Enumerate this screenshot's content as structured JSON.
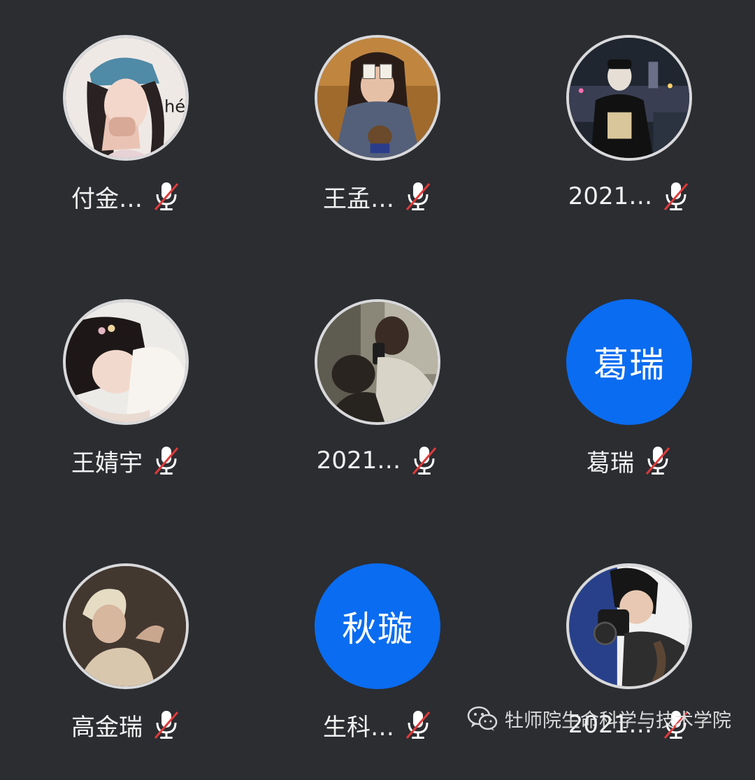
{
  "participants": [
    {
      "name": "付金…",
      "avatar": "photo",
      "mic": "muted"
    },
    {
      "name": "王孟…",
      "avatar": "photo",
      "mic": "muted"
    },
    {
      "name": "2021…",
      "avatar": "photo",
      "mic": "muted"
    },
    {
      "name": "王婧宇",
      "avatar": "photo",
      "mic": "muted"
    },
    {
      "name": "2021…",
      "avatar": "photo",
      "mic": "muted"
    },
    {
      "name": "葛瑞",
      "avatar": "initials",
      "initials": "葛瑞",
      "mic": "muted"
    },
    {
      "name": "高金瑞",
      "avatar": "photo",
      "mic": "muted"
    },
    {
      "name": "生科…",
      "avatar": "initials",
      "initials": "秋璇",
      "mic": "muted"
    },
    {
      "name": "2021…",
      "avatar": "photo",
      "mic": "muted"
    }
  ],
  "watermark": {
    "text": "牡师院生命科学与技术学院",
    "icon": "wechat-icon"
  },
  "colors": {
    "background": "#2b2d31",
    "initials_bg": "#0a6cf0",
    "mute_slash": "#e03a3a"
  }
}
